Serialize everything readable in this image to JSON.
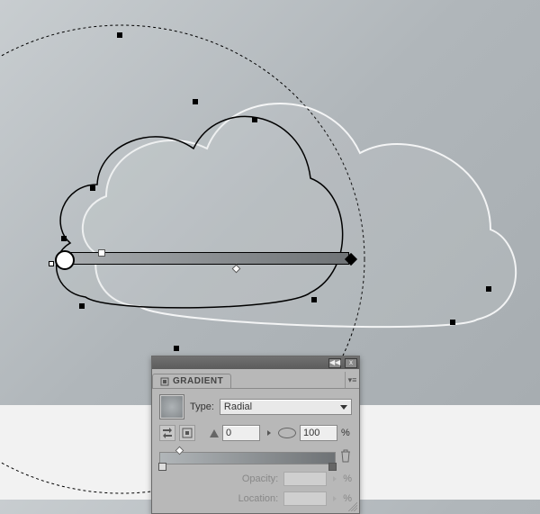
{
  "panel": {
    "title": "GRADIENT",
    "type_label": "Type:",
    "type_value": "Radial",
    "angle_value": "0",
    "aspect_value": "100",
    "percent": "%",
    "opacity_label": "Opacity:",
    "location_label": "Location:",
    "opacity_value": "",
    "location_value": ""
  },
  "icons": {
    "close": "x",
    "collapse": "◀◀",
    "menu": "▾≡",
    "trash": "trash-icon"
  }
}
